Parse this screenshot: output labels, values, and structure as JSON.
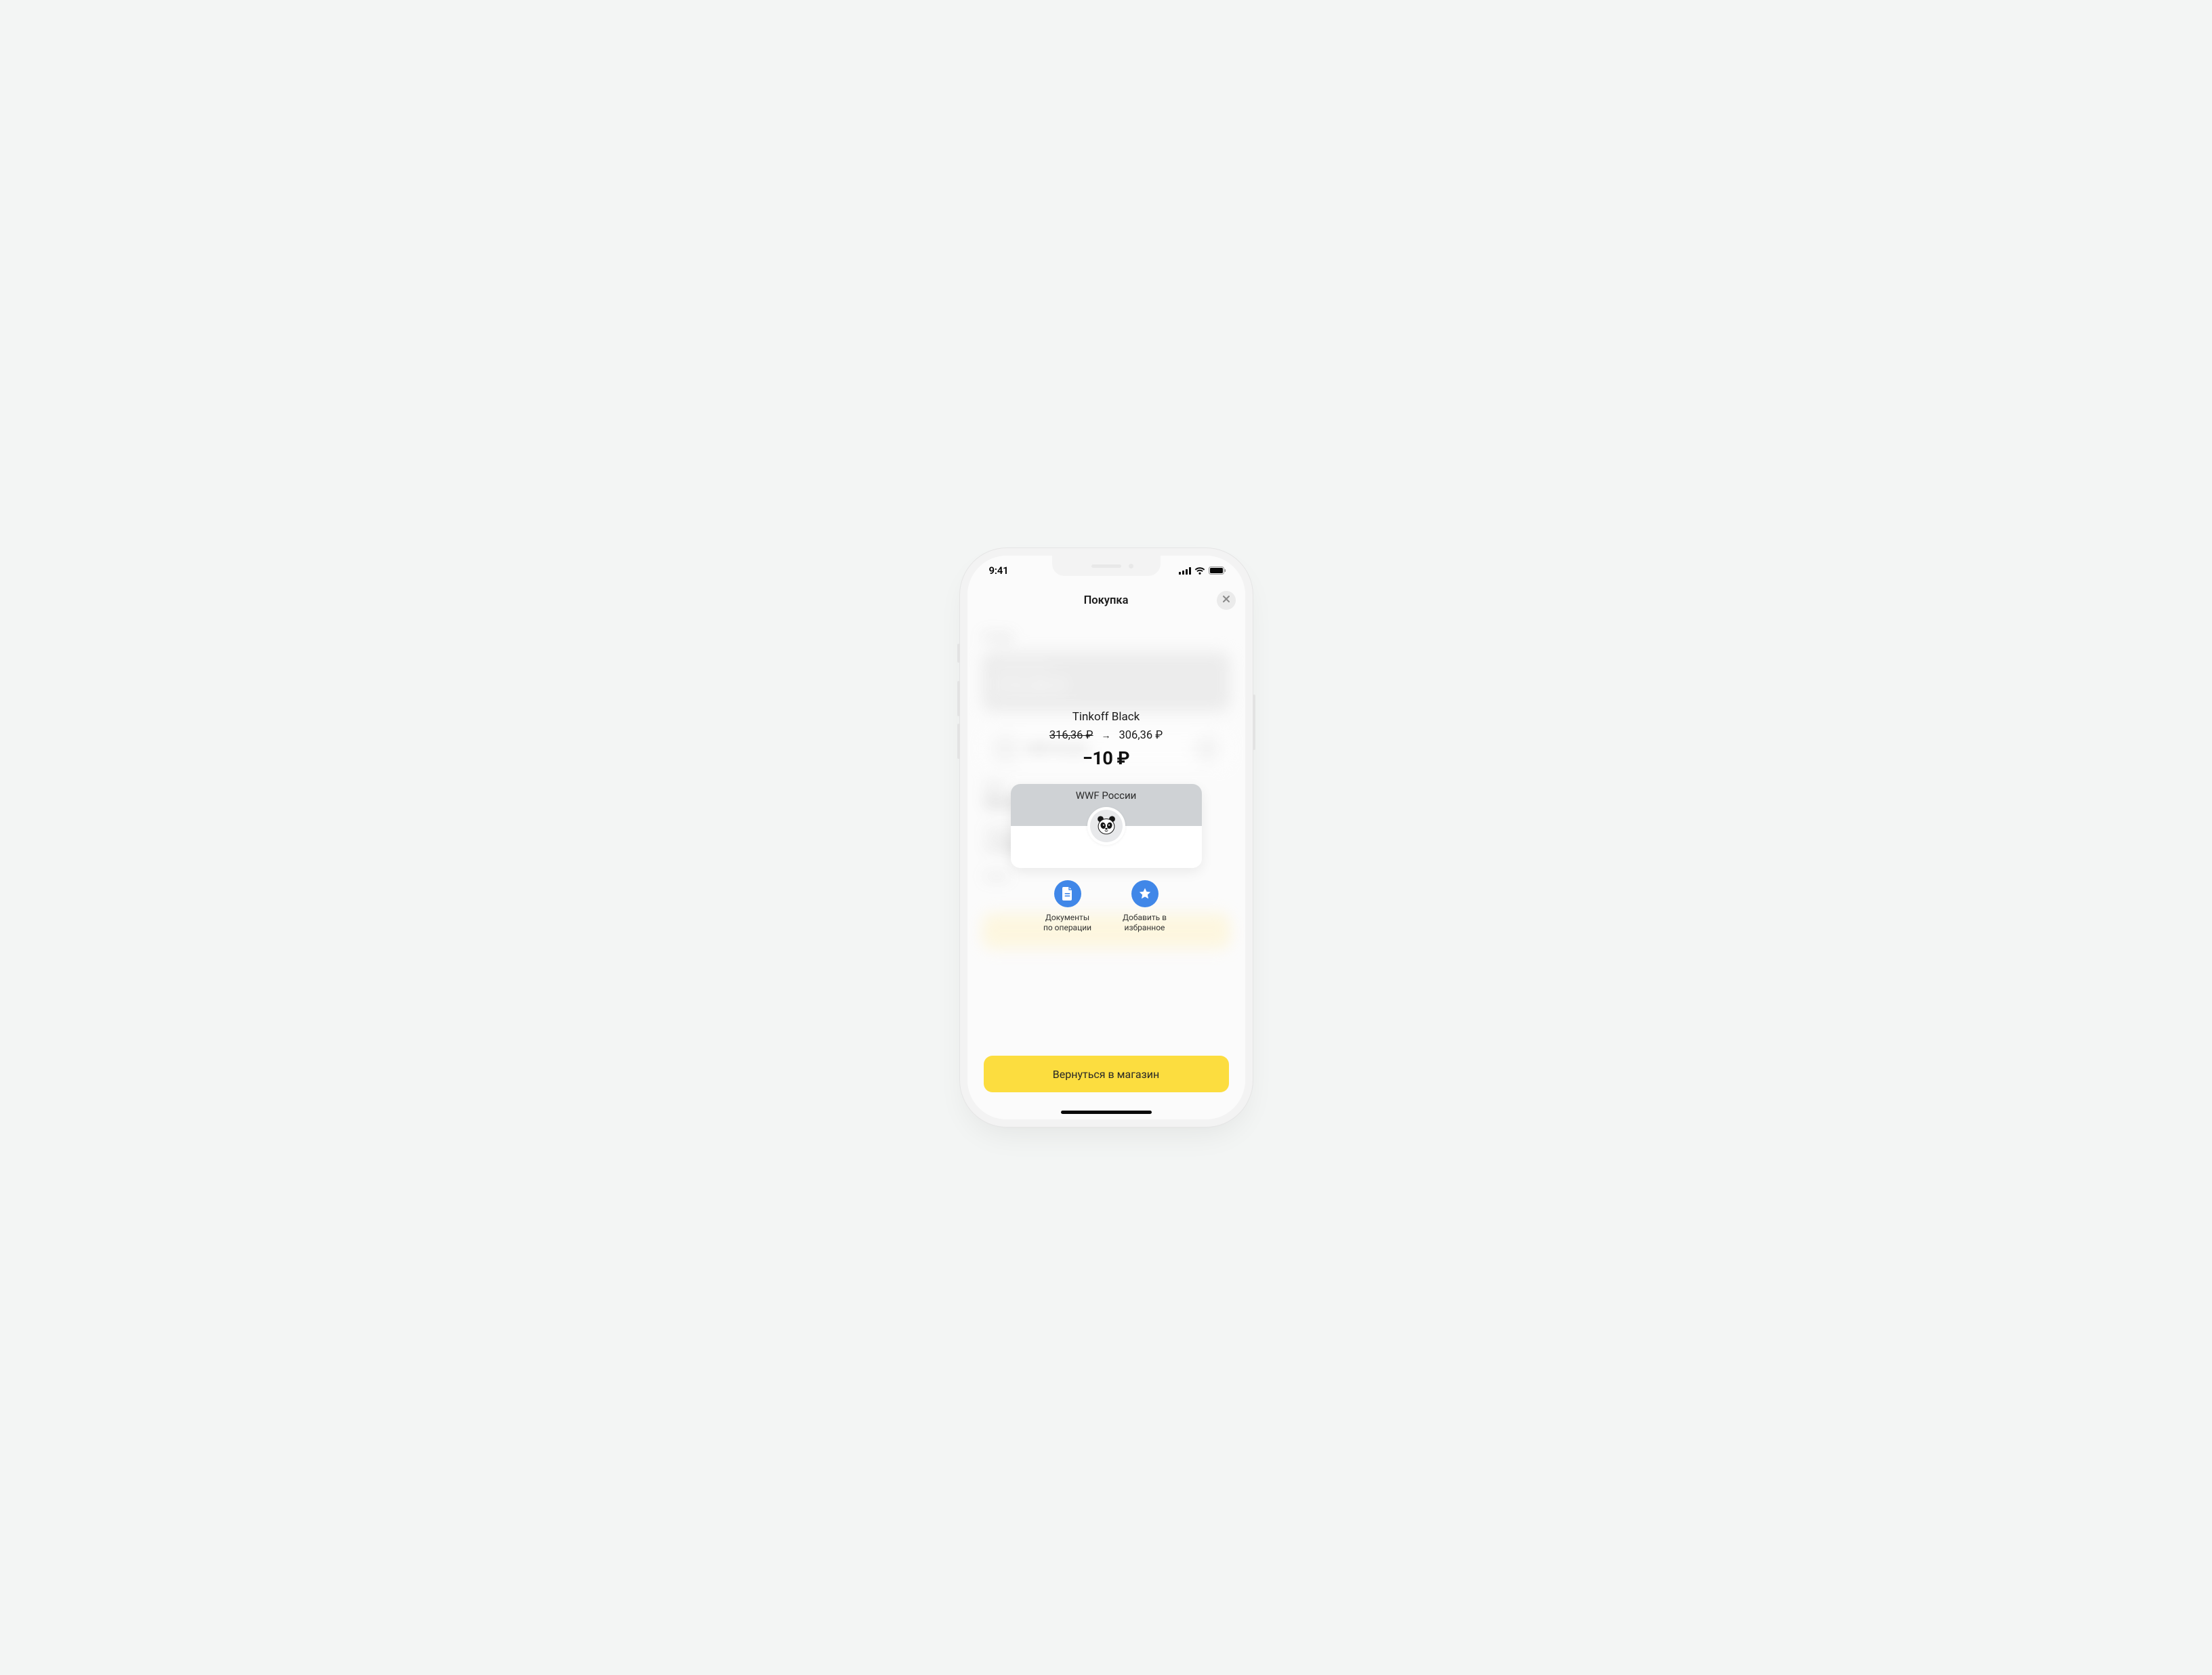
{
  "status": {
    "time": "9:41"
  },
  "header": {
    "title": "Покупка"
  },
  "account": {
    "name": "Tinkoff Black",
    "balance_before": "316,36 ₽",
    "balance_after": "306,36 ₽",
    "delta": "−10 ₽"
  },
  "merchant": {
    "name": "WWF России",
    "logo_icon": "panda-icon"
  },
  "actions": {
    "documents": {
      "label_l1": "Документы",
      "label_l2": "по операции"
    },
    "favorite": {
      "label_l1": "Добавить в",
      "label_l2": "избранное"
    }
  },
  "primary_button": {
    "label": "Вернуться в магазин"
  },
  "colors": {
    "accent_yellow": "#fcdd3f",
    "action_blue": "#4087e8",
    "merchant_top": "#cfd2d5"
  }
}
